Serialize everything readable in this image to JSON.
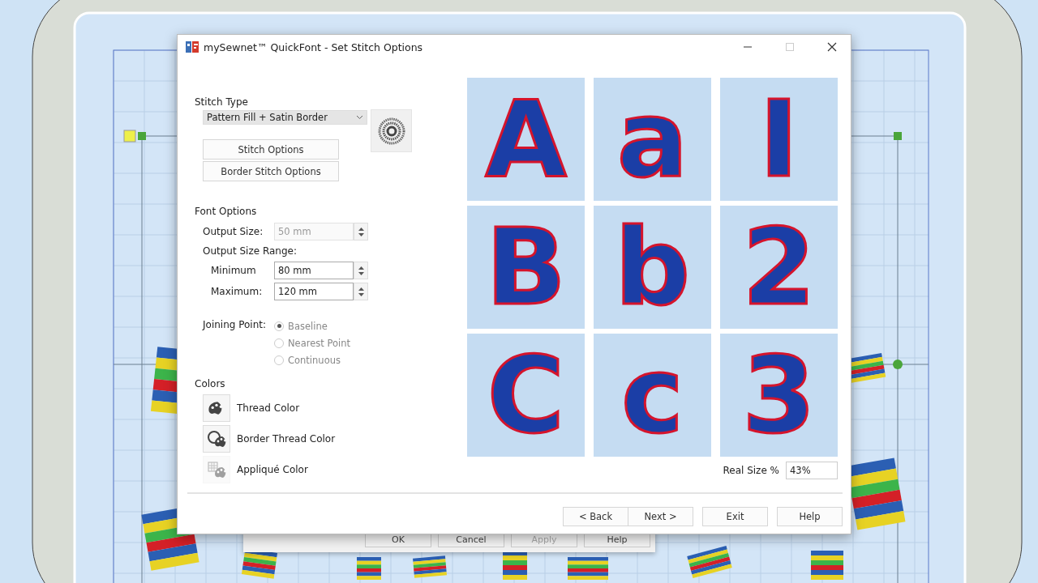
{
  "window": {
    "title": "mySewnet™ QuickFont - Set Stitch Options"
  },
  "stitch_type": {
    "label": "Stitch Type",
    "value": "Pattern Fill + Satin Border"
  },
  "stitch_buttons": [
    "Stitch Options",
    "Border Stitch Options"
  ],
  "font_options": {
    "heading": "Font Options",
    "output_size": {
      "label": "Output Size:",
      "value": "50 mm",
      "disabled": true
    },
    "range_label": "Output Size Range:",
    "minimum": {
      "label": "Minimum",
      "value": "80 mm",
      "disabled": false
    },
    "maximum": {
      "label": "Maximum:",
      "value": "120 mm",
      "disabled": false
    }
  },
  "joining_point": {
    "label": "Joining Point:",
    "disabled": true,
    "options": [
      {
        "label": "Baseline",
        "selected": true
      },
      {
        "label": "Nearest Point",
        "selected": false
      },
      {
        "label": "Continuous",
        "selected": false
      }
    ]
  },
  "colors": {
    "heading": "Colors",
    "items": [
      {
        "label": "Thread Color",
        "kind": "palette",
        "disabled": false
      },
      {
        "label": "Border Thread Color",
        "kind": "border",
        "disabled": false
      },
      {
        "label": "Appliqué Color",
        "kind": "applique",
        "disabled": true
      }
    ]
  },
  "preview": {
    "glyphs": [
      "A",
      "a",
      "I",
      "B",
      "b",
      "2",
      "C",
      "c",
      "3"
    ]
  },
  "real_size": {
    "label": "Real Size %",
    "value": "43%"
  },
  "buttons": [
    "< Back",
    "Next >",
    "Exit",
    "Help"
  ],
  "background_dialog": {
    "buttons": [
      {
        "label": "OK",
        "disabled": false
      },
      {
        "label": "Cancel",
        "disabled": false
      },
      {
        "label": "Apply",
        "disabled": true
      },
      {
        "label": "Help",
        "disabled": false
      }
    ]
  }
}
